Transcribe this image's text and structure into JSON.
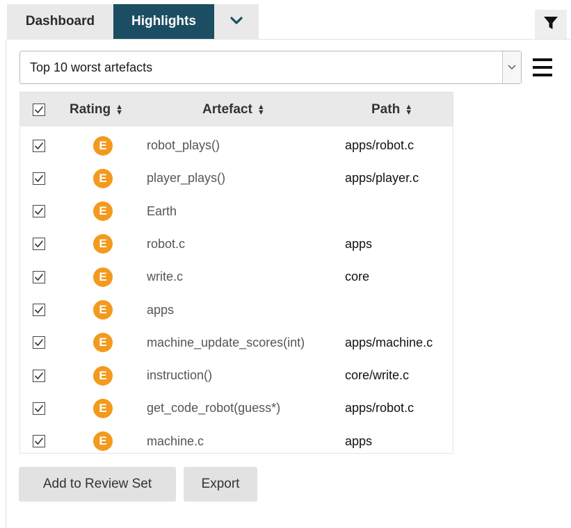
{
  "tabs": {
    "dashboard": "Dashboard",
    "highlights": "Highlights",
    "more_icon": "chevron-down-icon",
    "filter_icon": "filter-icon"
  },
  "highlight_select": {
    "value": "Top 10 worst artefacts",
    "arrow_icon": "chevron-down-icon",
    "menu_icon": "hamburger-menu-icon"
  },
  "table": {
    "headers": {
      "rating": "Rating",
      "artefact": "Artefact",
      "path": "Path"
    },
    "select_all_checked": true,
    "rows": [
      {
        "checked": true,
        "rating": "E",
        "artefact": "robot_plays()",
        "path": "apps/robot.c"
      },
      {
        "checked": true,
        "rating": "E",
        "artefact": "player_plays()",
        "path": "apps/player.c"
      },
      {
        "checked": true,
        "rating": "E",
        "artefact": "Earth",
        "path": ""
      },
      {
        "checked": true,
        "rating": "E",
        "artefact": "robot.c",
        "path": "apps"
      },
      {
        "checked": true,
        "rating": "E",
        "artefact": "write.c",
        "path": "core"
      },
      {
        "checked": true,
        "rating": "E",
        "artefact": "apps",
        "path": ""
      },
      {
        "checked": true,
        "rating": "E",
        "artefact": "machine_update_scores(int)",
        "path": "apps/machine.c"
      },
      {
        "checked": true,
        "rating": "E",
        "artefact": "instruction()",
        "path": "core/write.c"
      },
      {
        "checked": true,
        "rating": "E",
        "artefact": "get_code_robot(guess*)",
        "path": "apps/robot.c"
      },
      {
        "checked": true,
        "rating": "E",
        "artefact": "machine.c",
        "path": "apps"
      }
    ]
  },
  "colors": {
    "active_tab": "#1c4e63",
    "rating_e": "#f39a1e"
  },
  "actions": {
    "add_to_review_set": "Add to Review Set",
    "export": "Export"
  }
}
